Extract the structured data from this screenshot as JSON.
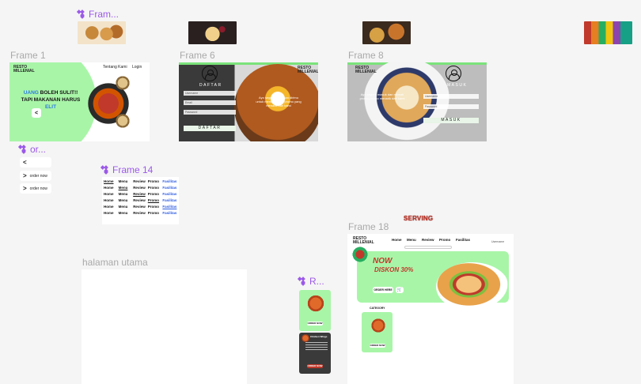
{
  "top_components": {
    "label": "Fram..."
  },
  "frames": {
    "frame1": {
      "label": "Frame 1",
      "brand": "RESTO\nMILLENIAL",
      "nav": [
        "Tentang Kami",
        "Login"
      ],
      "headline_line1_a": "UANG",
      "headline_line1_b": " BOLEH SULIT!!",
      "headline_line2_a": "TAPI MAKANAN HARUS ",
      "headline_line2_b": "ELIT",
      "arrow": "<"
    },
    "frame6": {
      "label": "Frame 6",
      "brand": "RESTO\nMILLENIAL",
      "form_title": "DAFTAR",
      "fields": [
        "Username",
        "Email",
        "Password"
      ],
      "button": "DAFTAR",
      "promo": "Ayo segera daftarkan dirimu\nuntuk mendapatkan promo yang\nmenarik dari kami"
    },
    "frame8": {
      "label": "Frame 8",
      "brand": "RESTO\nMILLENIAL",
      "form_title": "MASUK",
      "fields": [
        "Username",
        "Password"
      ],
      "button": "MASUK",
      "promo": "Ayo segera masuk dan nikmati\npromo-promo menarik dari kami"
    },
    "or_component": {
      "label": "or...",
      "items": [
        {
          "chevron": "<",
          "text": ""
        },
        {
          "chevron": ">",
          "text": "order now"
        },
        {
          "chevron": ">",
          "text": "order now"
        }
      ]
    },
    "frame14": {
      "label": "Frame 14",
      "columns": [
        "Home",
        "Menu",
        "Review",
        "Promo",
        "Fasilitas"
      ],
      "rows": 6
    },
    "halaman_utama": {
      "label": "halaman utama"
    },
    "r_component": {
      "label": "R...",
      "btn1": "ORDER NOW",
      "btn2": "ORDER NOW",
      "title2": "Chicken Wings"
    },
    "frame18": {
      "label": "Frame 18",
      "top_text": "SERVING",
      "brand": "RESTO\nMILLENIAL",
      "nav": [
        "Home",
        "Menu",
        "Review",
        "Promo",
        "Fasilitas"
      ],
      "profile": "Username",
      "now": "NOW",
      "discount": "DISKON 30%",
      "order_button": "ORDER HERE",
      "category": "CATEGORY",
      "card_button": "ORDER NOW"
    }
  },
  "colors": {
    "accent_green": "#a8f5a8",
    "component_purple": "#9b59e8",
    "label_gray": "#a9a9a9",
    "promo_red": "#c0392b"
  }
}
